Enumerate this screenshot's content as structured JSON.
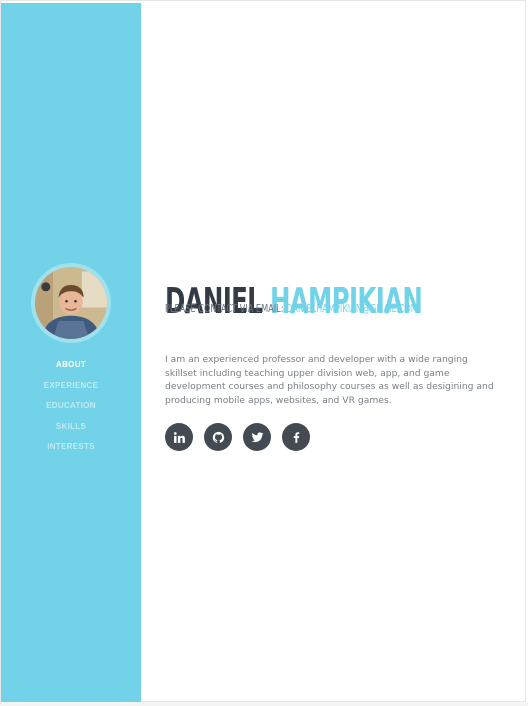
{
  "profile": {
    "first_name": "DANIEL",
    "last_name": "HAMPIKIAN",
    "contact_label": "PLEASE CONTACT VIA EMAIL: ",
    "email": "DANIELHAMPIKIAN@GMAIL.COM",
    "bio": "I am an experienced professor and developer with a wide ranging skillset including teaching upper division web, app, and game development courses and philosophy courses as well as desigining and producing mobile apps, websites, and VR games."
  },
  "nav": {
    "items": [
      {
        "label": "ABOUT",
        "active": true
      },
      {
        "label": "EXPERIENCE",
        "active": false
      },
      {
        "label": "EDUCATION",
        "active": false
      },
      {
        "label": "SKILLS",
        "active": false
      },
      {
        "label": "INTERESTS",
        "active": false
      }
    ]
  },
  "social": {
    "icons": [
      "linkedin-icon",
      "github-icon",
      "twitter-icon",
      "facebook-icon"
    ]
  },
  "colors": {
    "accent": "#72d3e8",
    "dark": "#333b44",
    "social_bg": "#434a52"
  }
}
